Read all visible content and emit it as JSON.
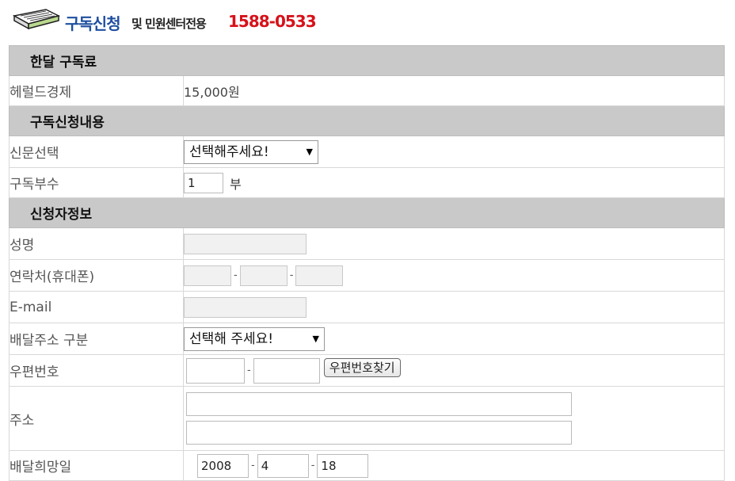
{
  "header": {
    "title": "구독신청",
    "subtitle": "및 민원센터전용",
    "phone": "1588-0533"
  },
  "sections": {
    "fee": "한달 구독료",
    "content": "구독신청내용",
    "applicant": "신청자정보"
  },
  "fee": {
    "label": "헤럴드경제",
    "value": "15,000원"
  },
  "newspaper": {
    "label": "신문선택",
    "selected": "선택해주세요!"
  },
  "copies": {
    "label": "구독부수",
    "value": "1",
    "unit": "부"
  },
  "name": {
    "label": "성명",
    "value": ""
  },
  "phone": {
    "label": "연락처(휴대폰)",
    "sep": "-"
  },
  "email": {
    "label": "E-mail",
    "value": ""
  },
  "delivery_type": {
    "label": "배달주소 구분",
    "selected": "선택해 주세요!"
  },
  "zipcode": {
    "label": "우편번호",
    "sep": "-",
    "button": "우편번호찾기"
  },
  "address": {
    "label": "주소"
  },
  "delivery_date": {
    "label": "배달희망일",
    "year": "2008",
    "month": "4",
    "day": "18",
    "sep": "-"
  }
}
